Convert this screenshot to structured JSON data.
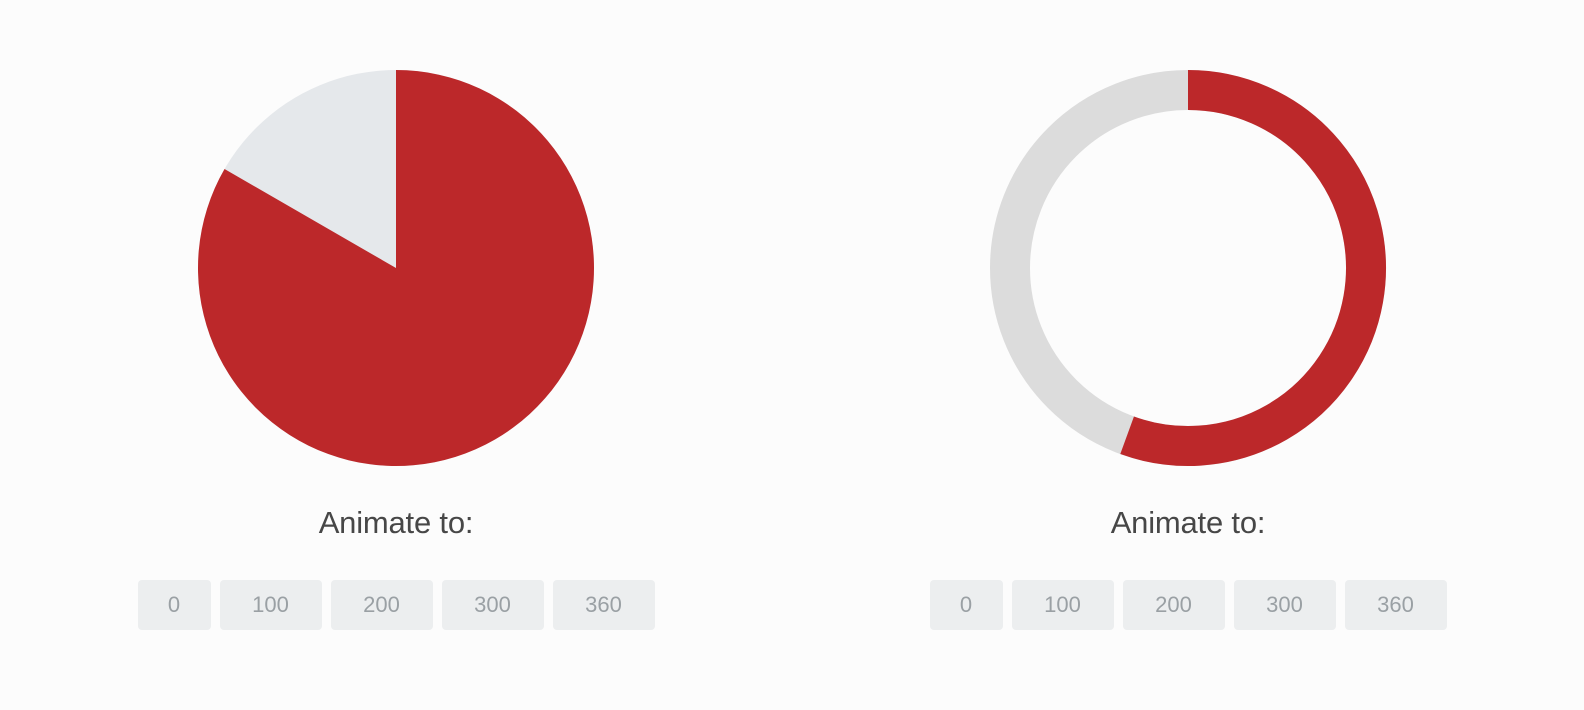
{
  "colors": {
    "fill": "#bc282a",
    "pie_track": "#e5e8eb",
    "ring_track": "#dcdcdc",
    "button_bg": "#eceeef",
    "button_text": "#9aa0a4",
    "caption_text": "#474747",
    "background": "#fcfcfc"
  },
  "pie": {
    "value_degrees": 300,
    "caption": "Animate to:",
    "buttons": [
      "0",
      "100",
      "200",
      "300",
      "360"
    ]
  },
  "ring": {
    "value_degrees": 200,
    "caption": "Animate to:",
    "buttons": [
      "0",
      "100",
      "200",
      "300",
      "360"
    ]
  }
}
